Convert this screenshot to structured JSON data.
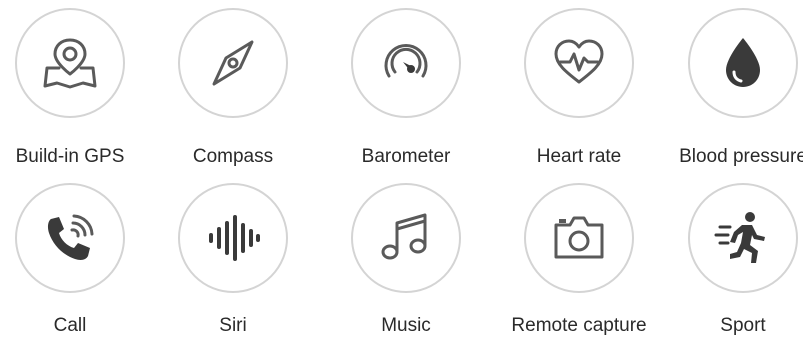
{
  "features": [
    {
      "label": "Build-in GPS",
      "icon": "map-pin-icon"
    },
    {
      "label": "Compass",
      "icon": "compass-icon"
    },
    {
      "label": "Barometer",
      "icon": "gauge-icon"
    },
    {
      "label": "Heart rate",
      "icon": "heart-pulse-icon"
    },
    {
      "label": "Blood pressure",
      "icon": "blood-drop-icon"
    },
    {
      "label": "Call",
      "icon": "phone-call-icon"
    },
    {
      "label": "Siri",
      "icon": "sound-wave-icon"
    },
    {
      "label": "Music",
      "icon": "music-note-icon"
    },
    {
      "label": "Remote capture",
      "icon": "camera-icon"
    },
    {
      "label": "Sport",
      "icon": "running-person-icon"
    }
  ],
  "colors": {
    "circle_border": "#d4d4d4",
    "icon_gray": "#5a5a5a",
    "icon_dark": "#3a3a3a",
    "text": "#2a2a2a"
  }
}
